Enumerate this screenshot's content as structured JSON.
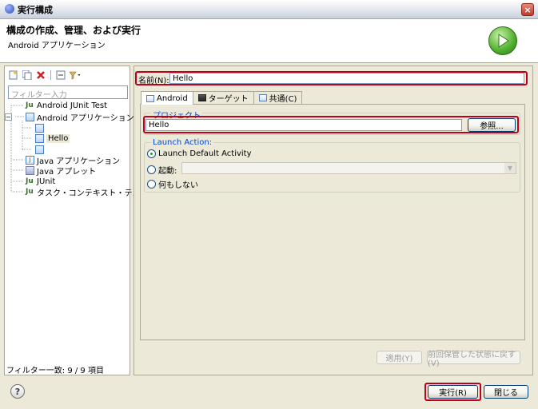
{
  "window": {
    "title": "実行構成",
    "close": "×"
  },
  "header": {
    "title": "構成の作成、管理、および実行",
    "subtitle": "Android アプリケーション"
  },
  "left": {
    "filter_placeholder": "フィルター入力",
    "tree": {
      "android_junit": "Android JUnit Test",
      "android_app": "Android アプリケーション",
      "hello": "Hello",
      "java_app": "Java アプリケーション",
      "java_applet": "Java アプレット",
      "junit": "JUnit",
      "task_test": "タスク・コンテキスト・テスト"
    },
    "status": "フィルター一致: 9 / 9 項目"
  },
  "main": {
    "name_label": "名前(N):",
    "name_value": "Hello",
    "tabs": [
      "Android",
      "ターゲット",
      "共通(C)"
    ],
    "project_group": "プロジェクト",
    "project_value": "Hello",
    "browse": "参照...",
    "launch_group": "Launch Action:",
    "launch_default": "Launch Default Activity",
    "launch_start": "起動:",
    "launch_none": "何もしない",
    "apply": "適用(Y)",
    "revert": "前回保管した状態に戻す(V)"
  },
  "footer": {
    "help": "?",
    "run": "実行(R)",
    "close": "閉じる"
  }
}
